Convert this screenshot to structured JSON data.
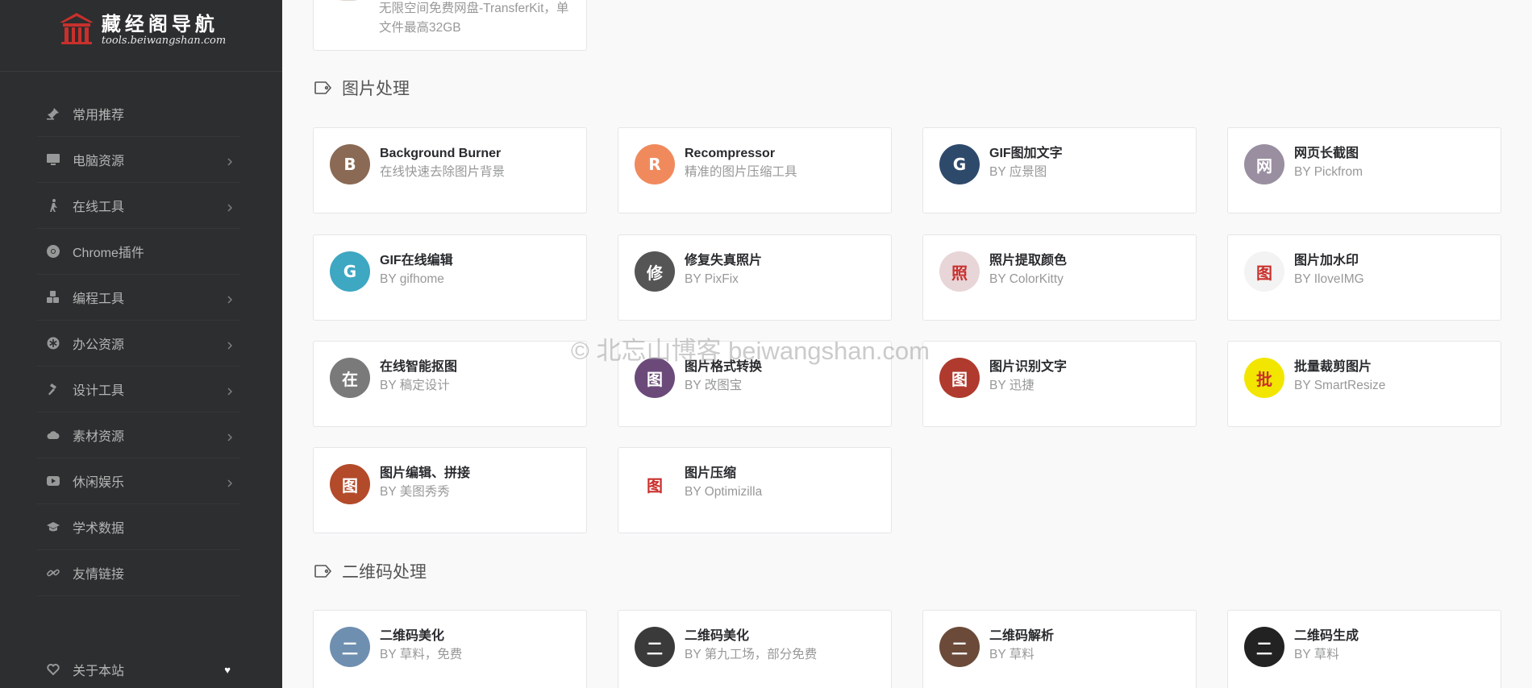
{
  "logo": {
    "title": "藏经阁导航",
    "subtitle": "tools.beiwangshan.com",
    "color": "#c9302c"
  },
  "sidebar": {
    "items": [
      {
        "label": "常用推荐",
        "icon": "pin-icon",
        "has_submenu": false
      },
      {
        "label": "电脑资源",
        "icon": "monitor-icon",
        "has_submenu": true
      },
      {
        "label": "在线工具",
        "icon": "walker-icon",
        "has_submenu": true
      },
      {
        "label": "Chrome插件",
        "icon": "chrome-icon",
        "has_submenu": false
      },
      {
        "label": "编程工具",
        "icon": "cubes-icon",
        "has_submenu": true
      },
      {
        "label": "办公资源",
        "icon": "asterisk-circle-icon",
        "has_submenu": true
      },
      {
        "label": "设计工具",
        "icon": "hammer-icon",
        "has_submenu": true
      },
      {
        "label": "素材资源",
        "icon": "cloud-icon",
        "has_submenu": true
      },
      {
        "label": "休闲娱乐",
        "icon": "video-play-icon",
        "has_submenu": true
      },
      {
        "label": "学术数据",
        "icon": "graduation-cap-icon",
        "has_submenu": false
      },
      {
        "label": "友情链接",
        "icon": "link-icon",
        "has_submenu": false
      }
    ],
    "about": {
      "label": "关于本站",
      "icon": "heart-outline-icon",
      "badge": "♥"
    }
  },
  "partial_card": {
    "desc": "无限空间免费网盘-TransferKit，单文件最高32GB"
  },
  "sections": [
    {
      "title": "图片处理",
      "cards": [
        {
          "title": "Background Burner",
          "desc": "在线快速去除图片背景",
          "avatar_color": "#8a6a55",
          "avatar_glyph": "B"
        },
        {
          "title": "Recompressor",
          "desc": "精准的图片压缩工具",
          "avatar_color": "#f08a5d",
          "avatar_glyph": "R"
        },
        {
          "title": "GIF图加文字",
          "desc": "BY 应景图",
          "avatar_color": "#2e4a6b",
          "avatar_glyph": "G"
        },
        {
          "title": "网页长截图",
          "desc": "BY Pickfrom",
          "avatar_color": "#9a8fa0",
          "avatar_glyph": "网"
        },
        {
          "title": "GIF在线编辑",
          "desc": "BY gifhome",
          "avatar_color": "#3ea7c2",
          "avatar_glyph": "G"
        },
        {
          "title": "修复失真照片",
          "desc": "BY PixFix",
          "avatar_color": "#555555",
          "avatar_glyph": "修"
        },
        {
          "title": "照片提取颜色",
          "desc": "BY ColorKitty",
          "avatar_color": "#e8d5d8",
          "avatar_glyph": "照"
        },
        {
          "title": "图片加水印",
          "desc": "BY IloveIMG",
          "avatar_color": "#f3f3f3",
          "avatar_glyph": "图"
        },
        {
          "title": "在线智能抠图",
          "desc": "BY 稿定设计",
          "avatar_color": "#7a7a7a",
          "avatar_glyph": "在"
        },
        {
          "title": "图片格式转换",
          "desc": "BY 改图宝",
          "avatar_color": "#6b4a7a",
          "avatar_glyph": "图"
        },
        {
          "title": "图片识别文字",
          "desc": "BY 迅捷",
          "avatar_color": "#b03a2e",
          "avatar_glyph": "图"
        },
        {
          "title": "批量裁剪图片",
          "desc": "BY SmartResize",
          "avatar_color": "#f2e600",
          "avatar_glyph": "批"
        },
        {
          "title": "图片编辑、拼接",
          "desc": "BY 美图秀秀",
          "avatar_color": "#b34a2a",
          "avatar_glyph": "图"
        },
        {
          "title": "图片压缩",
          "desc": "BY Optimizilla",
          "avatar_color": "#ffffff",
          "avatar_glyph": "图"
        }
      ]
    },
    {
      "title": "二维码处理",
      "cards": [
        {
          "title": "二维码美化",
          "desc": "BY 草料，免费",
          "avatar_color": "#6f8fb0",
          "avatar_glyph": "二"
        },
        {
          "title": "二维码美化",
          "desc": "BY 第九工场，部分免费",
          "avatar_color": "#3a3a3a",
          "avatar_glyph": "二"
        },
        {
          "title": "二维码解析",
          "desc": "BY 草料",
          "avatar_color": "#6b4a3a",
          "avatar_glyph": "二"
        },
        {
          "title": "二维码生成",
          "desc": "BY 草料",
          "avatar_color": "#222222",
          "avatar_glyph": "二"
        }
      ]
    }
  ],
  "watermark": "© 北忘山博客 beiwangshan.com"
}
